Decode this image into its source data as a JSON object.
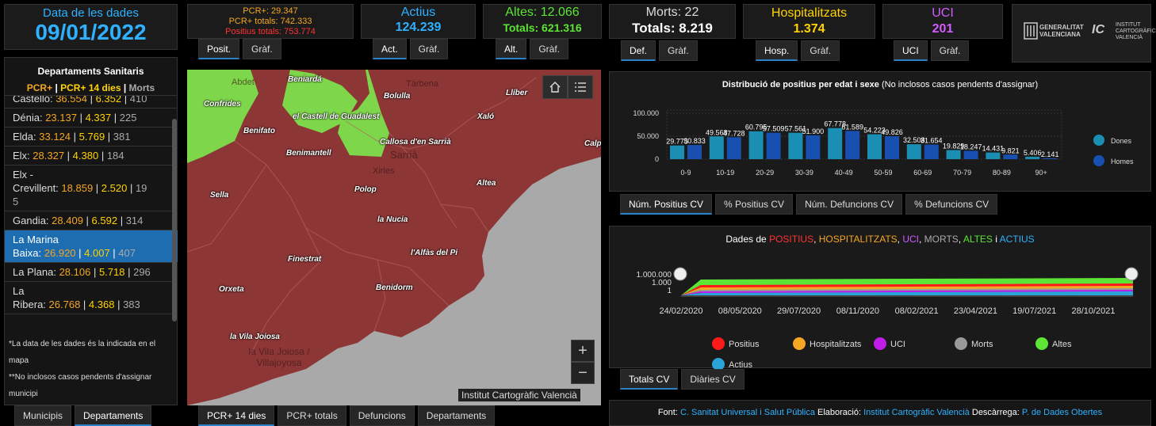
{
  "date_panel": {
    "label": "Data de les dades",
    "date": "09/01/2022"
  },
  "sidebar": {
    "title": "Departaments Sanitaris",
    "legend_a": "PCR+",
    "legend_b": "PCR+ 14 dies",
    "legend_c": "Morts",
    "depts": [
      {
        "name": "Castelló:",
        "a": "36.554",
        "b": "6.352",
        "c": "410"
      },
      {
        "name": "Dénia:",
        "a": "23.137",
        "b": "4.337",
        "c": "225"
      },
      {
        "name": "Elda:",
        "a": "33.124",
        "b": "5.769",
        "c": "381"
      },
      {
        "name": "Elx:",
        "a": "28.327",
        "b": "4.380",
        "c": "184"
      },
      {
        "name1": "Elx -",
        "name2": "Crevillent:",
        "a": "18.859",
        "b": "2.520",
        "c": "19",
        "c2": "5"
      },
      {
        "name": "Gandia:",
        "a": "28.409",
        "b": "6.592",
        "c": "314"
      },
      {
        "name1": "La Marina",
        "name2": "Baixa:",
        "a": "26.920",
        "b": "4.007",
        "c": "407"
      },
      {
        "name": "La Plana:",
        "a": "28.106",
        "b": "5.718",
        "c": "296"
      },
      {
        "name1": "La",
        "name2": "Ribera:",
        "a": "26.768",
        "b": "4.368",
        "c": "383"
      }
    ],
    "note1": "*La data de les dades és la indicada en el mapa",
    "note2": "**No inclosos casos pendents d'assignar municipi",
    "tabs": [
      "Municipis",
      "Departaments"
    ]
  },
  "pcr_panel": {
    "line1": "PCR+: 29.347",
    "line2": "PCR+ totals: 742.333",
    "line3": "Positius totals: 753.774",
    "tabs": [
      "Posit.",
      "Gràf."
    ]
  },
  "actius_panel": {
    "label": "Actius",
    "value": "124.239",
    "tabs": [
      "Act.",
      "Gràf."
    ]
  },
  "altes_panel": {
    "label": "Altes: 12.066",
    "value": "Totals: 621.316",
    "tabs": [
      "Alt.",
      "Gràf."
    ]
  },
  "morts_panel": {
    "label": "Morts: 22",
    "value": "Totals: 8.219",
    "tabs": [
      "Def.",
      "Gràf."
    ]
  },
  "hosp_panel": {
    "label": "Hospitalitzats",
    "value": "1.374",
    "tabs": [
      "Hosp.",
      "Gràf."
    ]
  },
  "uci_panel": {
    "label": "UCI",
    "value": "201",
    "tabs": [
      "UCI",
      "Gràf."
    ]
  },
  "logos": {
    "gva1": "GENERALITAT",
    "gva2": "VALENCIANA",
    "icv1": "INSTITUT",
    "icv2": "CARTOGRÀFIC",
    "icv3": "VALENCIÀ"
  },
  "map": {
    "labels": [
      "Abdet",
      "Beniardá",
      "Confrides",
      "Bolulla",
      "Tàrbena",
      "Llíber",
      "el Castell de Guadalest",
      "Xaló",
      "Benifato",
      "Callosa d'en Sarrià",
      "Calp",
      "Benimantell",
      "Sarrià",
      "Xirles",
      "Sella",
      "Polop",
      "Altea",
      "la Nucia",
      "Finestrat",
      "l'Alfàs del Pi",
      "Orxeta",
      "Benidorm",
      "la Vila Joiosa",
      "la Vila Joiosa / Villajoyosa"
    ],
    "attribution": "Institut Cartogràfic Valencià",
    "tabs": [
      "PCR+ 14 dies",
      "PCR+ totals",
      "Defuncions",
      "Departaments"
    ]
  },
  "age_chart": {
    "tabs": [
      "Núm. Positius CV",
      "% Positius CV",
      "Núm. Defuncions CV",
      "% Defuncions CV"
    ]
  },
  "chart_data": [
    {
      "type": "bar",
      "title": "Distribució de positius per edat i sexe",
      "subtitle": "(No inclosos casos pendents d'assignar)",
      "categories": [
        "0-9",
        "10-19",
        "20-29",
        "30-39",
        "40-49",
        "50-59",
        "60-69",
        "70-79",
        "80-89",
        "90+"
      ],
      "series": [
        {
          "name": "Dones",
          "values": [
            29775,
            49568,
            60795,
            57561,
            67778,
            54223,
            32508,
            19829,
            14431,
            5406
          ],
          "labels": [
            "29.775",
            "49.568",
            "60.795",
            "57.561",
            "67.778",
            "54.223",
            "32.508",
            "19.829",
            "14.431",
            "5.406"
          ]
        },
        {
          "name": "Homes",
          "values": [
            30833,
            47728,
            57509,
            51900,
            61589,
            49826,
            31654,
            18247,
            9821,
            2141
          ],
          "labels": [
            "30.833",
            "47.728",
            "57.509",
            "51.900",
            "61.589",
            "49.826",
            "31.654",
            "18.247",
            "9.821",
            "2.141"
          ]
        }
      ],
      "yticks": [
        "100.000",
        "50.000",
        "0"
      ],
      "ylim": [
        0,
        100000
      ],
      "colors": {
        "Dones": "#1a8fb3",
        "Homes": "#1750b0"
      }
    },
    {
      "type": "line",
      "title_prefix": "Dades de",
      "title_parts": [
        "POSITIUS",
        "HOSPITALITZATS",
        "UCI",
        "MORTS",
        "ALTES",
        "ACTIUS"
      ],
      "title_conj": "i",
      "yscale": "log",
      "yticks": [
        "1.000.000",
        "1.000",
        "1"
      ],
      "xticks": [
        "24/02/2020",
        "08/05/2020",
        "29/07/2020",
        "08/11/2020",
        "08/02/2021",
        "23/04/2021",
        "19/07/2021",
        "28/10/2021"
      ],
      "legend": [
        "Positius",
        "Hospitalitzats",
        "UCI",
        "Morts",
        "Altes",
        "Actius"
      ],
      "colors": [
        "#ff1a1a",
        "#f5a623",
        "#c01ee8",
        "#9a9a9a",
        "#5ce535",
        "#2aa3d6"
      ],
      "tabs": [
        "Totals CV",
        "Diàries CV"
      ]
    }
  ],
  "footer": {
    "font_label": "Font:",
    "font_value": "C. Sanitat Universal i Salut Pública",
    "elab_label": "Elaboració:",
    "elab_value": "Institut Cartogràfic Valencià",
    "desc_label": "Descàrrega:",
    "desc_value": "P. de Dades Obertes"
  }
}
